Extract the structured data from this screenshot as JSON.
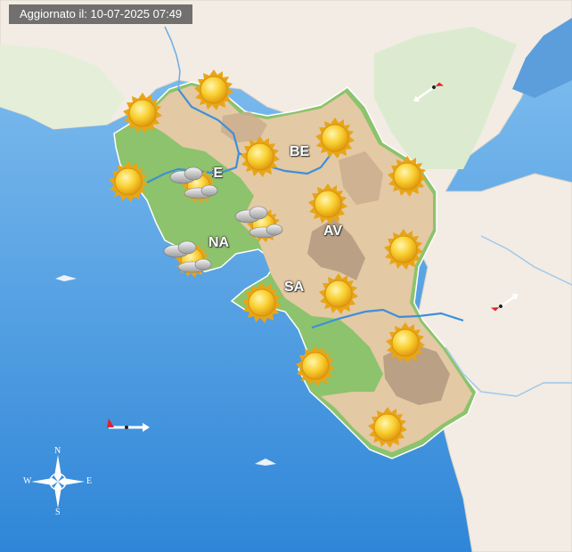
{
  "header": {
    "label": "Aggiornato il:",
    "value": "10-07-2025 07:49"
  },
  "provinces": [
    {
      "id": "be",
      "label": "BE"
    },
    {
      "id": "av",
      "label": "AV"
    },
    {
      "id": "na",
      "label": "NA"
    },
    {
      "id": "sa",
      "label": "SA"
    },
    {
      "id": "ce",
      "label": "CE"
    }
  ],
  "compass": {
    "n": "N",
    "s": "S",
    "e": "E",
    "w": "W"
  },
  "weather_icons": [
    {
      "name": "sun-icon-1",
      "type": "sunny"
    },
    {
      "name": "sun-icon-2",
      "type": "sunny"
    },
    {
      "name": "sun-icon-3",
      "type": "sunny"
    },
    {
      "name": "sun-icon-4",
      "type": "sunny"
    },
    {
      "name": "sun-icon-5",
      "type": "sunny"
    },
    {
      "name": "sun-icon-6",
      "type": "sunny"
    },
    {
      "name": "sun-icon-7",
      "type": "sunny"
    },
    {
      "name": "sun-icon-8",
      "type": "sunny"
    },
    {
      "name": "sun-icon-9",
      "type": "sunny"
    },
    {
      "name": "sun-icon-10",
      "type": "sunny"
    },
    {
      "name": "sun-icon-11",
      "type": "sunny"
    },
    {
      "name": "sun-icon-12",
      "type": "sunny"
    },
    {
      "name": "sun-icon-13",
      "type": "sunny"
    },
    {
      "name": "partly-cloudy-icon-1",
      "type": "partly-cloudy"
    },
    {
      "name": "partly-cloudy-icon-2",
      "type": "partly-cloudy"
    },
    {
      "name": "partly-cloudy-icon-3",
      "type": "partly-cloudy"
    }
  ],
  "wind_arrows": [
    {
      "name": "wind-arrow-northeast",
      "direction": "SW"
    },
    {
      "name": "wind-arrow-east",
      "direction": "NE"
    },
    {
      "name": "wind-arrow-sea",
      "direction": "E"
    }
  ],
  "colors": {
    "sea": "#5aa6e6",
    "land_outside": "#f2ece4",
    "lowland": "#8cc36c",
    "hills": "#e3c9a4",
    "mountains": "#b39a80",
    "river": "#3e8fd8",
    "sun": "#f7c52c"
  }
}
